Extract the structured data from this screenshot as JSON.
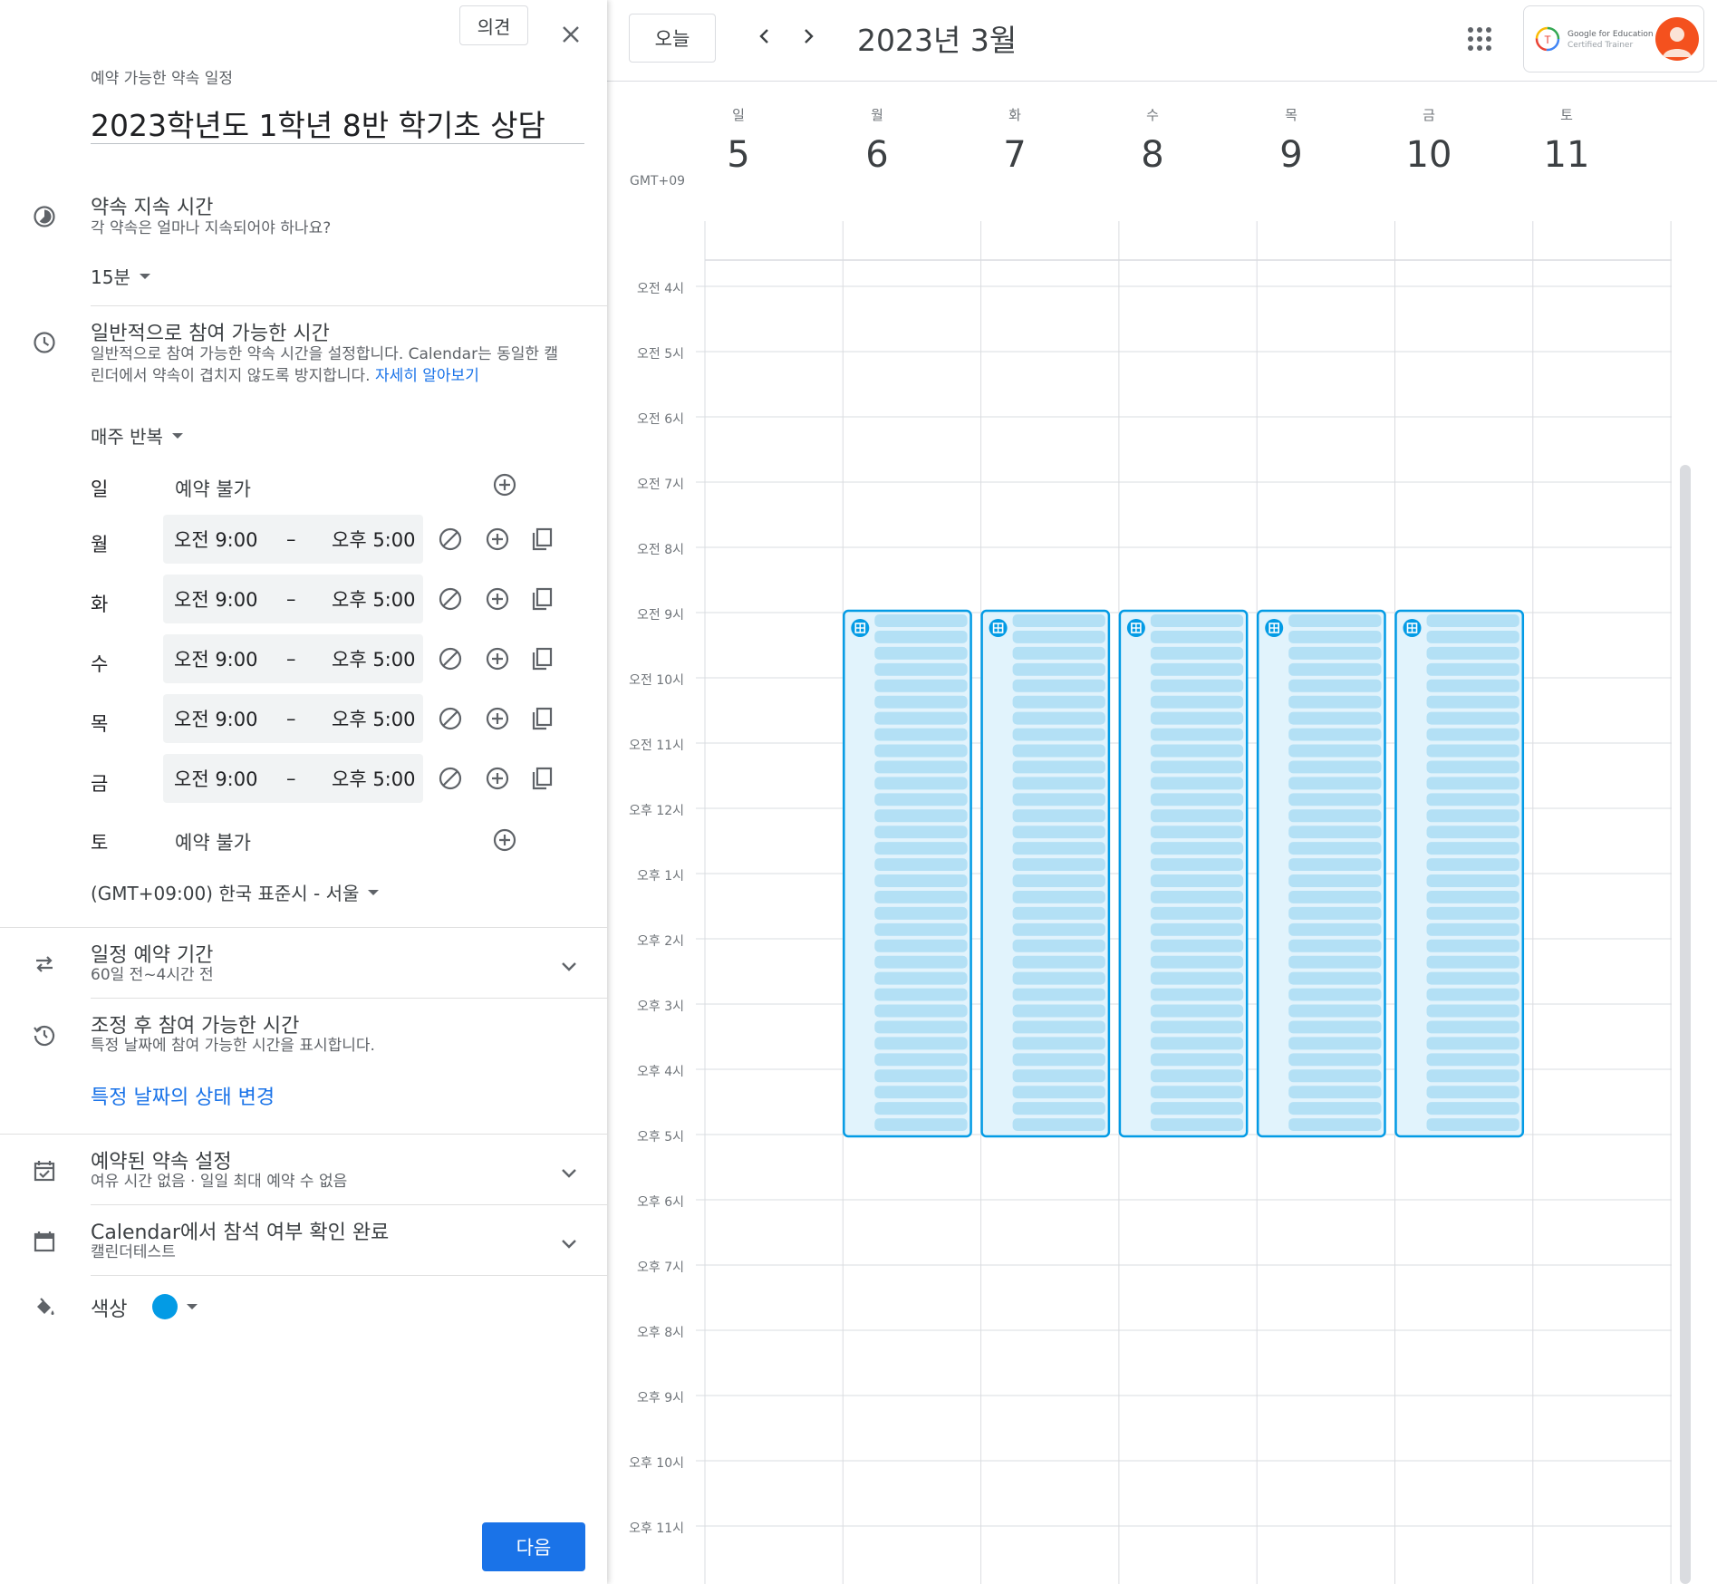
{
  "panel": {
    "feedback_label": "의견",
    "header_small": "예약 가능한 약속 일정",
    "title": "2023학년도 1학년 8반 학기초 상담",
    "duration": {
      "title": "약속 지속 시간",
      "subtitle": "각 약속은 얼마나 지속되어야 하나요?",
      "value": "15분"
    },
    "general_availability": {
      "title": "일반적으로 참여 가능한 시간",
      "desc_line1": "일반적으로 참여 가능한 약속 시간을 설정합니다. Calendar는 동일한 캘",
      "desc_line2": "린더에서 약속이 겹치지 않도록 방지합니다.",
      "learn_more": "자세히 알아보기",
      "repeat": "매주 반복",
      "days": [
        {
          "day": "일",
          "available": false,
          "text": "예약 불가"
        },
        {
          "day": "월",
          "available": true,
          "start": "오전 9:00",
          "end": "오후 5:00"
        },
        {
          "day": "화",
          "available": true,
          "start": "오전 9:00",
          "end": "오후 5:00"
        },
        {
          "day": "수",
          "available": true,
          "start": "오전 9:00",
          "end": "오후 5:00"
        },
        {
          "day": "목",
          "available": true,
          "start": "오전 9:00",
          "end": "오후 5:00"
        },
        {
          "day": "금",
          "available": true,
          "start": "오전 9:00",
          "end": "오후 5:00"
        },
        {
          "day": "토",
          "available": false,
          "text": "예약 불가"
        }
      ],
      "dash": "–",
      "timezone": "(GMT+09:00) 한국 표준시 - 서울"
    },
    "booking_window": {
      "title": "일정 예약 기간",
      "subtitle": "60일 전~4시간 전"
    },
    "adjusted": {
      "title": "조정 후 참여 가능한 시간",
      "subtitle": "특정 날짜에 참여 가능한 시간을 표시합니다.",
      "link": "특정 날짜의 상태 변경"
    },
    "booked_settings": {
      "title": "예약된 약속 설정",
      "subtitle": "여유 시간 없음 · 일일 최대 예약 수 없음"
    },
    "calendar_confirm": {
      "title": "Calendar에서 참석 여부 확인 완료",
      "subtitle": "캘린더테스트"
    },
    "color": {
      "label": "색상",
      "value": "#039be5"
    },
    "next_label": "다음"
  },
  "calendar": {
    "today_label": "오늘",
    "month_title": "2023년 3월",
    "timezone_label": "GMT+09",
    "account": {
      "badge_line1": "Google for Education",
      "badge_line2": "Certified Trainer"
    },
    "days": [
      {
        "dow": "일",
        "date": "5"
      },
      {
        "dow": "월",
        "date": "6"
      },
      {
        "dow": "화",
        "date": "7"
      },
      {
        "dow": "수",
        "date": "8"
      },
      {
        "dow": "목",
        "date": "9"
      },
      {
        "dow": "금",
        "date": "10"
      },
      {
        "dow": "토",
        "date": "11"
      }
    ],
    "hours": [
      "오전 4시",
      "오전 5시",
      "오전 6시",
      "오전 7시",
      "오전 8시",
      "오전 9시",
      "오전 10시",
      "오전 11시",
      "오후 12시",
      "오후 1시",
      "오후 2시",
      "오후 3시",
      "오후 4시",
      "오후 5시",
      "오후 6시",
      "오후 7시",
      "오후 8시",
      "오후 9시",
      "오후 10시",
      "오후 11시"
    ],
    "event_color": "#039be5",
    "slot_color": "#b3e0f5"
  }
}
